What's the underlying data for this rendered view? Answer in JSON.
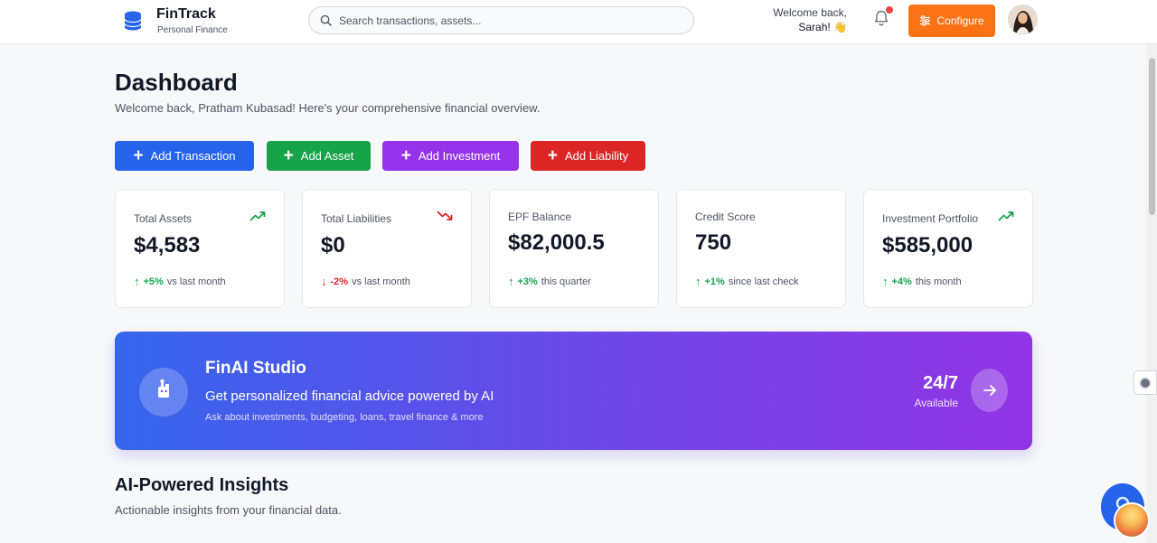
{
  "header": {
    "brand": {
      "name": "FinTrack",
      "subtitle": "Personal Finance",
      "logo_icon": "database-icon",
      "logo_color": "#2563eb"
    },
    "search": {
      "placeholder": "Search transactions, assets..."
    },
    "welcome": {
      "line1": "Welcome back,",
      "line2": "Sarah! 👋"
    },
    "notifications": {
      "icon": "bell-icon",
      "has_unread": true
    },
    "configure_label": "Configure",
    "configure_color": "#f97316"
  },
  "dashboard": {
    "title": "Dashboard",
    "subtitle": "Welcome back, Pratham Kubasad! Here's your comprehensive financial overview."
  },
  "actions": [
    {
      "label": "Add Transaction",
      "color": "#2563eb"
    },
    {
      "label": "Add Asset",
      "color": "#16a34a"
    },
    {
      "label": "Add Investment",
      "color": "#9333ea"
    },
    {
      "label": "Add Liability",
      "color": "#dc2626"
    }
  ],
  "stats": [
    {
      "label": "Total Assets",
      "value": "$4,583",
      "trend_icon": "trending-up-icon",
      "direction": "up",
      "arrow": "↑",
      "change": "+5%",
      "period": "vs last month"
    },
    {
      "label": "Total Liabilities",
      "value": "$0",
      "trend_icon": "trending-down-icon",
      "direction": "down",
      "arrow": "↓",
      "change": "-2%",
      "period": "vs last month"
    },
    {
      "label": "EPF Balance",
      "value": "$82,000.5",
      "direction": "up",
      "arrow": "↑",
      "change": "+3%",
      "period": "this quarter"
    },
    {
      "label": "Credit Score",
      "value": "750",
      "direction": "up",
      "arrow": "↑",
      "change": "+1%",
      "period": "since last check"
    },
    {
      "label": "Investment Portfolio",
      "value": "$585,000",
      "trend_icon": "trending-up-icon",
      "direction": "up",
      "arrow": "↑",
      "change": "+4%",
      "period": "this month"
    }
  ],
  "finai": {
    "title": "FinAI Studio",
    "subtitle": "Get personalized financial advice powered by AI",
    "note": "Ask about investments, budgeting, loans, travel finance & more",
    "availability": "24/7",
    "availability_label": "Available",
    "gradient": [
      "#3566ec",
      "#9134e6"
    ]
  },
  "insights": {
    "title": "AI-Powered Insights",
    "subtitle": "Actionable insights from your financial data."
  }
}
